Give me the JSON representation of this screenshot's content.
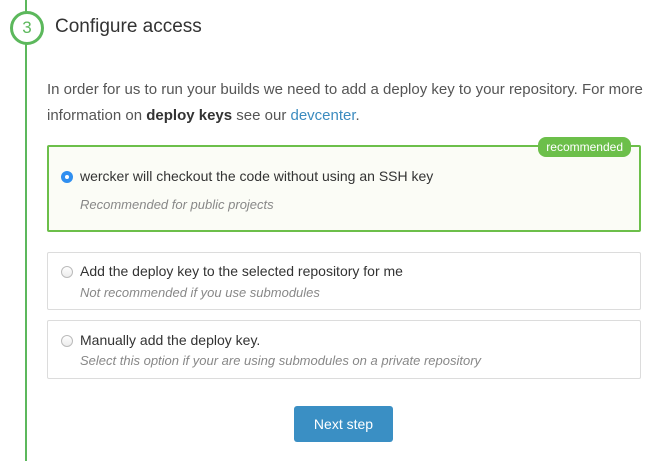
{
  "step": {
    "number": "3",
    "title": "Configure access"
  },
  "intro": {
    "text_before": "In order for us to run your builds we need to add a deploy key to your repository. For more information on ",
    "bold": "deploy keys",
    "text_middle": " see our ",
    "link": "devcenter",
    "text_after": "."
  },
  "options": [
    {
      "label": "wercker will checkout the code without using an SSH key",
      "description": "Recommended for public projects",
      "badge": "recommended",
      "selected": true
    },
    {
      "label": "Add the deploy key to the selected repository for me",
      "description": "Not recommended if you use submodules",
      "selected": false
    },
    {
      "label": "Manually add the deploy key.",
      "description": "Select this option if your are using submodules on a private repository",
      "selected": false
    }
  ],
  "next_button": {
    "label": "Next step"
  },
  "colors": {
    "accent_green": "#6cbf4a",
    "radio_blue": "#2f8ff0",
    "button_blue": "#3a8fc4",
    "link_blue": "#3b8bbf"
  }
}
